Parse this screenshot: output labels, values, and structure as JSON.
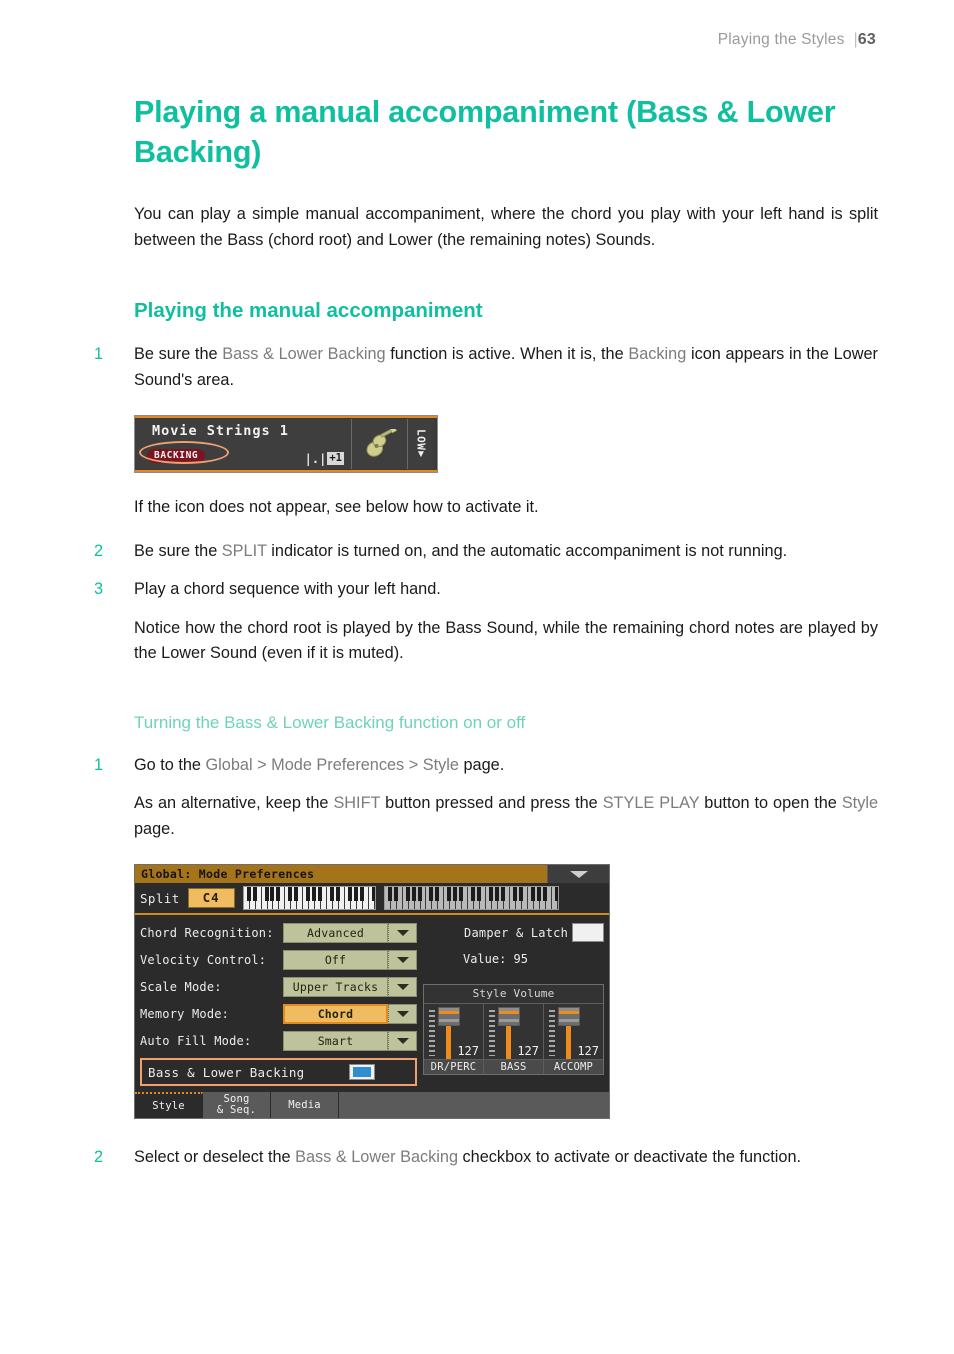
{
  "header": {
    "running_title": "Playing the Styles",
    "separator": "|",
    "page_number": "63"
  },
  "title": "Playing a manual accompaniment (Bass & Lower Backing)",
  "intro": "You can play a simple manual accompaniment, where the chord you play with your left hand is split between the Bass (chord root) and Lower (the remaining notes) Sounds.",
  "section1": {
    "heading": "Playing the manual accompaniment",
    "step1": {
      "num": "1",
      "t1": "Be sure the ",
      "ui1": "Bass & Lower Backing",
      "t2": " function is active. When it is, the ",
      "ui2": "Backing",
      "t3": " icon appears in the Lower Sound's area."
    },
    "after_figure": "If the icon does not appear, see below how to activate it.",
    "step2": {
      "num": "2",
      "t1": "Be sure the ",
      "ui1": "SPLIT",
      "t2": " indicator is turned on, and the automatic accompaniment is not running."
    },
    "step3": {
      "num": "3",
      "text": "Play a chord sequence with your left hand."
    },
    "note": "Notice how the chord root is played by the Bass Sound, while the remaining chord notes are played by the Lower Sound (even if it is muted)."
  },
  "section2": {
    "heading": "Turning the Bass & Lower Backing function on or off",
    "step1": {
      "num": "1",
      "t1": "Go to the ",
      "ui1": "Global",
      "sep1": " > ",
      "ui2": "Mode Preferences",
      "sep2": " > ",
      "ui3": "Style",
      "t2": " page."
    },
    "alt": {
      "t1": "As an alternative, keep the ",
      "ui1": "SHIFT",
      "t2": " button pressed and press the ",
      "ui2": "STYLE PLAY",
      "t3": " button to open the ",
      "ui3": "Style",
      "t4": " page."
    },
    "step2": {
      "num": "2",
      "t1": "Select or deselect the ",
      "ui1": "Bass & Lower Backing",
      "t2": " checkbox to activate or deactivate the function."
    }
  },
  "figure_sound_slot": {
    "sound_name": "Movie Strings 1",
    "badge": "BACKING",
    "octave_chip": "+1",
    "octave_bars": "|.|",
    "slot_label": "LOW"
  },
  "figure_global_page": {
    "window_title": "Global: Mode Preferences",
    "split_label": "Split",
    "split_value": "C4",
    "parameters": [
      {
        "label": "Chord Recognition:",
        "value": "Advanced",
        "highlighted": false
      },
      {
        "label": "Velocity Control:",
        "value": "Off",
        "highlighted": false
      },
      {
        "label": "Scale Mode:",
        "value": "Upper Tracks",
        "highlighted": false
      },
      {
        "label": "Memory Mode:",
        "value": "Chord",
        "highlighted": true
      },
      {
        "label": "Auto Fill Mode:",
        "value": "Smart",
        "highlighted": false
      }
    ],
    "checkbox_row": {
      "label": "Bass & Lower Backing",
      "checked": true
    },
    "damper": {
      "label": "Damper & Latch",
      "checked": false
    },
    "value_row": "Value: 95",
    "style_volume": {
      "title": "Style Volume",
      "faders": [
        {
          "name": "DR/PERC",
          "value": "127"
        },
        {
          "name": "BASS",
          "value": "127"
        },
        {
          "name": "ACCOMP",
          "value": "127"
        }
      ]
    },
    "tabs": [
      {
        "label": "Style",
        "active": true
      },
      {
        "label": "Song\n& Seq.",
        "active": false
      },
      {
        "label": "Media",
        "active": false
      }
    ]
  },
  "colors": {
    "accent_teal": "#0fbfa0",
    "accent_mint": "#6ed3b8",
    "ui_grey": "#7c7c7c",
    "panel_gold": "#a5741a",
    "highlight_orange": "#f0a070",
    "checkbox_blue": "#2e8fd0"
  }
}
